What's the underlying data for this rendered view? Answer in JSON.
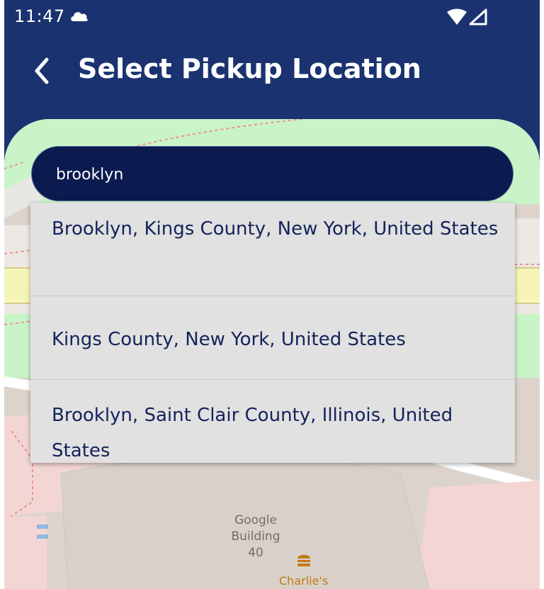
{
  "status_bar": {
    "time": "11:47",
    "icons": [
      "cloud-icon",
      "wifi-icon",
      "signal-icon"
    ]
  },
  "header": {
    "title": "Select Pickup Location",
    "back_icon": "chevron-left-icon"
  },
  "search": {
    "value": "brooklyn",
    "placeholder": ""
  },
  "suggestions": [
    {
      "label": "Brooklyn, Kings County, New York, United States"
    },
    {
      "label": "Kings County, New York, United States"
    },
    {
      "label": "Brooklyn, Saint Clair County, Illinois, United States"
    }
  ],
  "map": {
    "building_label": "Google Building 40",
    "poi_label": "Charlie's",
    "poi_icon": "burger-icon"
  },
  "colors": {
    "header_bg": "#1a3370",
    "search_bg": "#0b1a4f",
    "suggestion_text": "#14235a",
    "suggestion_bg": "#e1e1e1",
    "park_green": "#c9f4c8",
    "road_yellow": "#f5f5b8"
  }
}
